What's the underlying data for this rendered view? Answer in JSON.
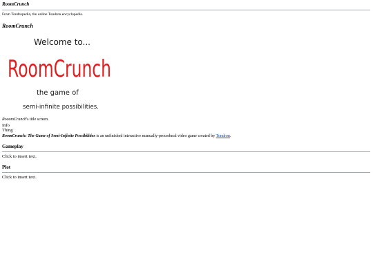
{
  "page": {
    "title": "RoomCrunch",
    "from_line": "From Tondropedia, the online Tondron encyclopedia."
  },
  "infobox": {
    "title": "RoomCrunch",
    "art": {
      "line1": "Welcome to...",
      "line2": "RoomCrunch",
      "line3": "the game of",
      "line4": "semi-infinite possibilities.",
      "ink_dark": "#1a1a1a",
      "ink_red": "#e02020"
    },
    "caption_italic": "RooomCrunch",
    "caption_rest": "'s title screen.",
    "rows": [
      "Info",
      "Thing"
    ]
  },
  "intro": {
    "bold": "RoomCrunch: The Game of Semi-Infinite Possibilities",
    "text": " is an unfinished interactive manually-procedural video game created by ",
    "link": "Tondron",
    "end": "."
  },
  "sections": [
    {
      "heading": "Gameplay",
      "body": "Click to insert text."
    },
    {
      "heading": "Plot",
      "body": "Click to insert text."
    }
  ]
}
